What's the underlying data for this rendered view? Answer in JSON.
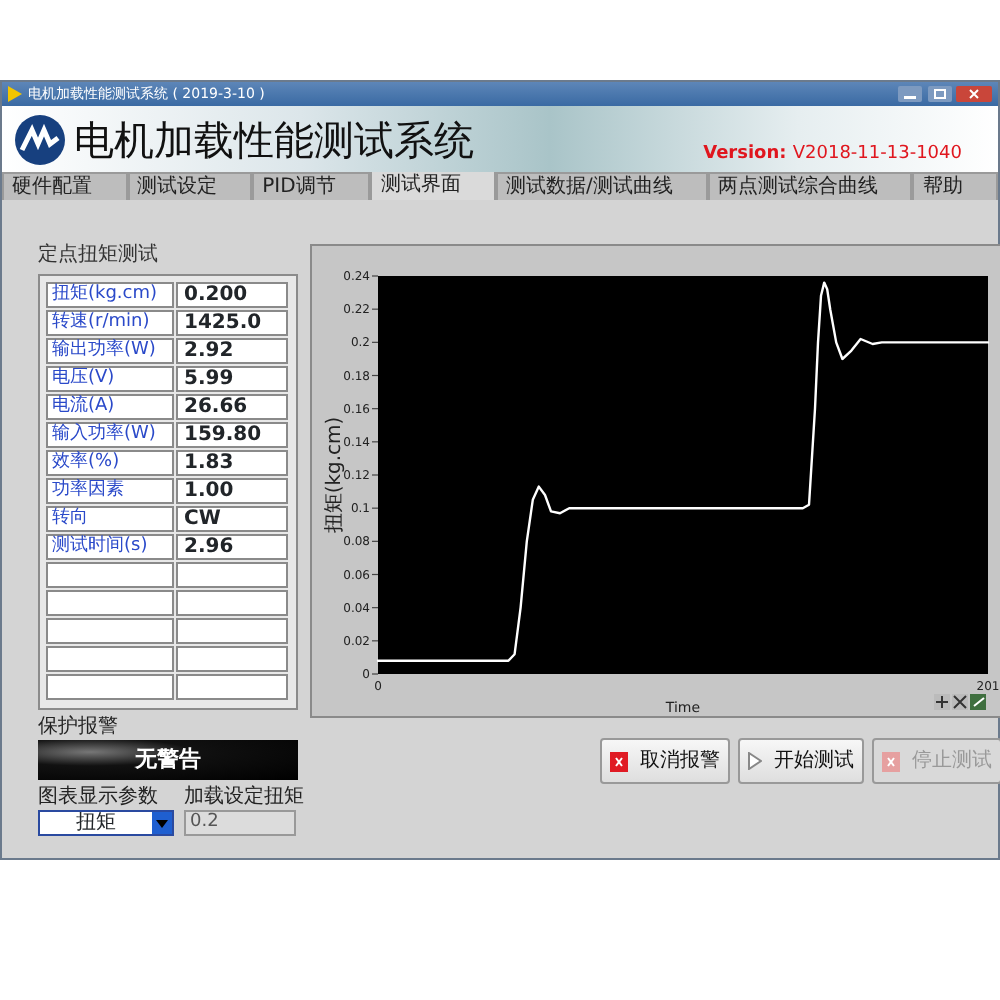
{
  "window": {
    "title": "电机加载性能测试系统 ( 2019-3-10 )"
  },
  "header": {
    "title": "电机加载性能测试系统",
    "version_label": "Version:",
    "version": "V2018-11-13-1040"
  },
  "tabs": [
    {
      "label": "硬件配置",
      "selected": false
    },
    {
      "label": "测试设定",
      "selected": false
    },
    {
      "label": "PID调节",
      "selected": false
    },
    {
      "label": "测试界面",
      "selected": true
    },
    {
      "label": "测试数据/测试曲线",
      "selected": false
    },
    {
      "label": "两点测试综合曲线",
      "selected": false
    },
    {
      "label": "帮助",
      "selected": false
    }
  ],
  "section_title": "定点扭矩测试",
  "readings": [
    {
      "label": "扭矩(kg.cm)",
      "value": "0.200"
    },
    {
      "label": "转速(r/min)",
      "value": "1425.0"
    },
    {
      "label": "输出功率(W)",
      "value": "2.92"
    },
    {
      "label": "电压(V)",
      "value": "5.99"
    },
    {
      "label": "电流(A)",
      "value": "26.66"
    },
    {
      "label": "输入功率(W)",
      "value": "159.80"
    },
    {
      "label": "效率(%)",
      "value": "1.83"
    },
    {
      "label": "功率因素",
      "value": "1.00"
    },
    {
      "label": "转向",
      "value": "CW"
    },
    {
      "label": "测试时间(s)",
      "value": "2.96"
    }
  ],
  "alarm": {
    "label": "保护报警",
    "text": "无警告"
  },
  "chart_parameter": {
    "label": "图表显示参数",
    "value": "扭矩"
  },
  "load_torque": {
    "label": "加载设定扭矩",
    "value": "0.2"
  },
  "chart": {
    "chart_data": {
      "type": "line",
      "ylabel": "扭矩(kg.cm)",
      "xlabel": "Time",
      "x": [
        0,
        43,
        45,
        47,
        49,
        51,
        53,
        55,
        57,
        60,
        63,
        70,
        100,
        140,
        142,
        144,
        145,
        146,
        147,
        148,
        149,
        151,
        153,
        156,
        159,
        163,
        166,
        201
      ],
      "series": [
        {
          "color": "#ffffff",
          "values": [
            0.008,
            0.008,
            0.012,
            0.04,
            0.08,
            0.105,
            0.113,
            0.108,
            0.098,
            0.097,
            0.1,
            0.1,
            0.1,
            0.1,
            0.102,
            0.16,
            0.2,
            0.228,
            0.236,
            0.232,
            0.22,
            0.2,
            0.19,
            0.195,
            0.202,
            0.199,
            0.2,
            0.2
          ]
        }
      ],
      "xlim": [
        0,
        201
      ],
      "ylim": [
        0,
        0.24
      ],
      "xticks": [
        0,
        201
      ],
      "yticks": [
        0,
        0.02,
        0.04,
        0.06,
        0.08,
        0.1,
        0.12,
        0.14,
        0.16,
        0.18,
        0.2,
        0.22,
        0.24
      ]
    }
  },
  "buttons": [
    {
      "label": "取消报警",
      "kind": "cancel",
      "disabled": false
    },
    {
      "label": "开始测试",
      "kind": "start",
      "disabled": false
    },
    {
      "label": "停止测试",
      "kind": "stop",
      "disabled": true
    }
  ]
}
